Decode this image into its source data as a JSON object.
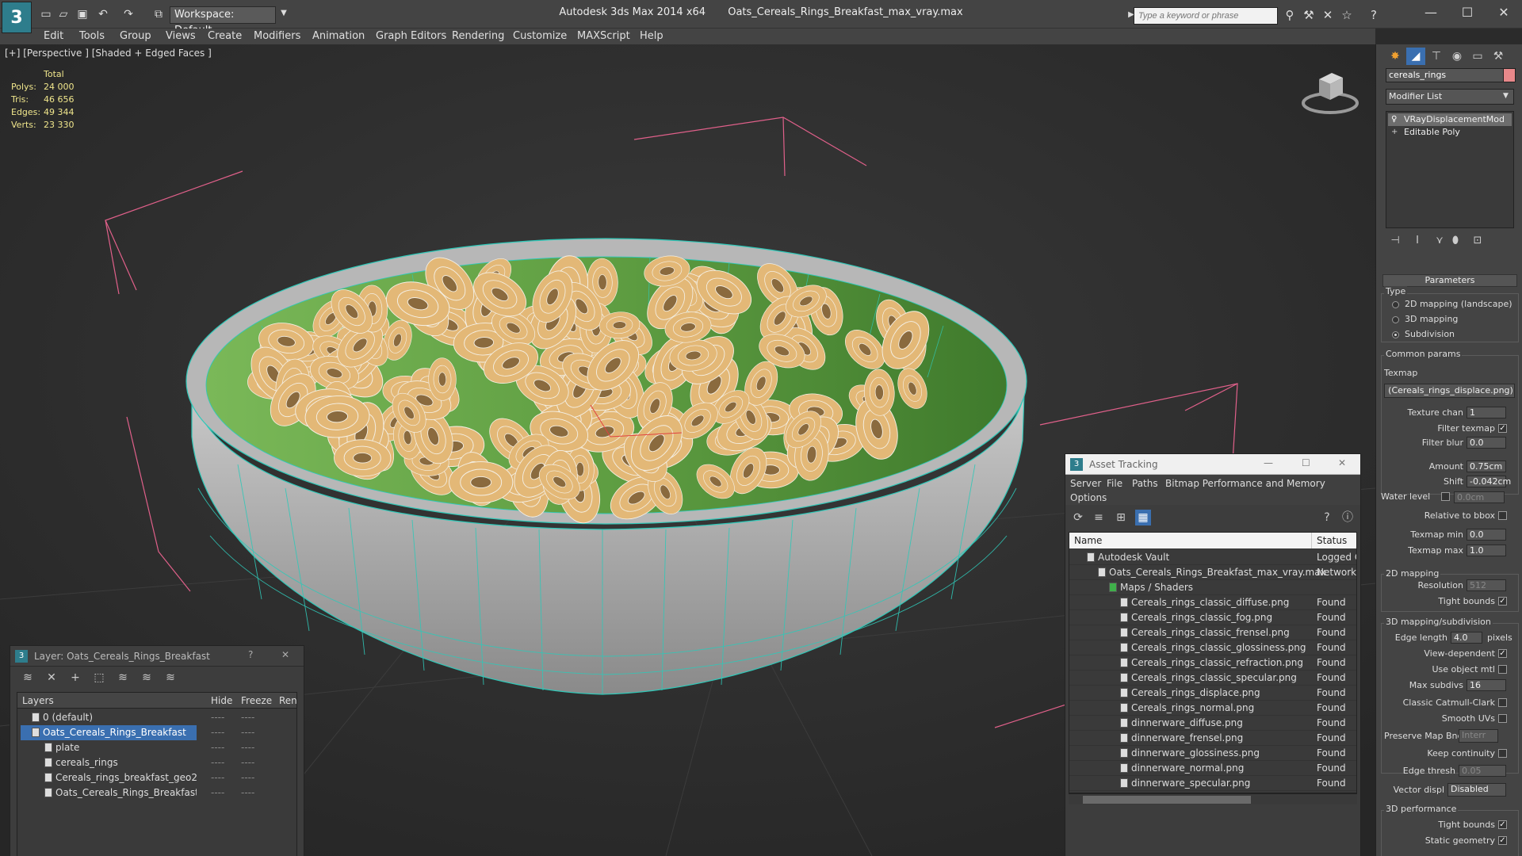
{
  "titlebar": {
    "app": "Autodesk 3ds Max  2014 x64",
    "file": "Oats_Cereals_Rings_Breakfast_max_vray.max",
    "workspace": "Workspace: Default",
    "search_placeholder": "Type a keyword or phrase",
    "logo_glyph": "3"
  },
  "menu": [
    "Edit",
    "Tools",
    "Group",
    "Views",
    "Create",
    "Modifiers",
    "Animation",
    "Graph Editors",
    "Rendering",
    "Customize",
    "MAXScript",
    "Help"
  ],
  "viewport": {
    "label": "[+] [Perspective ] [Shaded + Edged Faces ]",
    "stats": {
      "header": "Total",
      "rows": [
        {
          "label": "Polys:",
          "value": "24 000"
        },
        {
          "label": "Tris:",
          "value": "46 656"
        },
        {
          "label": "Edges:",
          "value": "49 344"
        },
        {
          "label": "Verts:",
          "value": "23 330"
        }
      ]
    },
    "colors": {
      "bowl_inner": "#6aa64a",
      "bowl_outer": "#a8a8a8",
      "wire": "#2fc8b8",
      "ring": "#e3b877",
      "bbox": "#e0608a"
    }
  },
  "layer_dialog": {
    "title": "Layer: Oats_Cereals_Rings_Breakfast",
    "help": "?",
    "close": "✕",
    "columns": [
      "Layers",
      "Hide",
      "Freeze",
      "Ren"
    ],
    "rows": [
      {
        "name": "0 (default)",
        "selected": false,
        "level": 1
      },
      {
        "name": "Oats_Cereals_Rings_Breakfast",
        "selected": true,
        "level": 1
      },
      {
        "name": "plate",
        "selected": false,
        "level": 2
      },
      {
        "name": "cereals_rings",
        "selected": false,
        "level": 2
      },
      {
        "name": "Cereals_rings_breakfast_geo2",
        "selected": false,
        "level": 2
      },
      {
        "name": "Oats_Cereals_Rings_Breakfast",
        "selected": false,
        "level": 2
      }
    ],
    "dash": "----"
  },
  "asset_dialog": {
    "title": "Asset Tracking",
    "menu": [
      "Server",
      "File",
      "Paths",
      "Bitmap Performance and Memory"
    ],
    "menu2": "Options",
    "columns": [
      "Name",
      "Status"
    ],
    "rows": [
      {
        "name": "Autodesk Vault",
        "status": "Logged C",
        "level": 1
      },
      {
        "name": "Oats_Cereals_Rings_Breakfast_max_vray.max",
        "status": "Network I",
        "level": 2
      },
      {
        "name": "Maps / Shaders",
        "status": "",
        "level": 3
      },
      {
        "name": "Cereals_rings_classic_diffuse.png",
        "status": "Found",
        "level": 4
      },
      {
        "name": "Cereals_rings_classic_fog.png",
        "status": "Found",
        "level": 4
      },
      {
        "name": "Cereals_rings_classic_frensel.png",
        "status": "Found",
        "level": 4
      },
      {
        "name": "Cereals_rings_classic_glossiness.png",
        "status": "Found",
        "level": 4
      },
      {
        "name": "Cereals_rings_classic_refraction.png",
        "status": "Found",
        "level": 4
      },
      {
        "name": "Cereals_rings_classic_specular.png",
        "status": "Found",
        "level": 4
      },
      {
        "name": "Cereals_rings_displace.png",
        "status": "Found",
        "level": 4
      },
      {
        "name": "Cereals_rings_normal.png",
        "status": "Found",
        "level": 4
      },
      {
        "name": "dinnerware_diffuse.png",
        "status": "Found",
        "level": 4
      },
      {
        "name": "dinnerware_frensel.png",
        "status": "Found",
        "level": 4
      },
      {
        "name": "dinnerware_glossiness.png",
        "status": "Found",
        "level": 4
      },
      {
        "name": "dinnerware_normal.png",
        "status": "Found",
        "level": 4
      },
      {
        "name": "dinnerware_specular.png",
        "status": "Found",
        "level": 4
      }
    ]
  },
  "command_panel": {
    "object_name": "cereals_rings",
    "modifier_list": "Modifier List",
    "stack": [
      "VRayDisplacementMod",
      "Editable Poly"
    ],
    "parameters_title": "Parameters",
    "type_label": "Type",
    "type_options": [
      {
        "label": "2D mapping (landscape)",
        "on": false
      },
      {
        "label": "3D mapping",
        "on": false
      },
      {
        "label": "Subdivision",
        "on": true
      }
    ],
    "common_label": "Common params",
    "texmap_label": "Texmap",
    "texmap_value": "(Cereals_rings_displace.png)",
    "texture_chan_label": "Texture chan",
    "texture_chan": "1",
    "filter_texmap_label": "Filter texmap",
    "filter_blur_label": "Filter blur",
    "filter_blur": "0.0",
    "amount_label": "Amount",
    "amount": "0.75cm",
    "shift_label": "Shift",
    "shift": "-0.042cm",
    "water_label": "Water level",
    "water": "0.0cm",
    "relative_label": "Relative to bbox",
    "texmap_min_label": "Texmap min",
    "texmap_min": "0.0",
    "texmap_max_label": "Texmap max",
    "texmap_max": "1.0",
    "map2d_label": "2D mapping",
    "resolution_label": "Resolution",
    "resolution": "512",
    "tight_label": "Tight bounds",
    "sub3d_label": "3D mapping/subdivision",
    "edge_len_label": "Edge length",
    "edge_len": "4.0",
    "pixels_label": "pixels",
    "view_dep_label": "View-dependent",
    "use_obj_label": "Use object mtl",
    "max_subdivs_label": "Max subdivs",
    "max_subdivs": "16",
    "catmull_label": "Classic Catmull-Clark",
    "smooth_uv_label": "Smooth UVs",
    "preserve_label": "Preserve Map Bnd",
    "preserve_value": "Interr",
    "keep_cont_label": "Keep continuity",
    "edge_thresh_label": "Edge thresh",
    "edge_thresh": "0.05",
    "vector_label": "Vector displ",
    "vector_value": "Disabled",
    "perf_label": "3D performance",
    "tight2_label": "Tight bounds",
    "static_label": "Static geometry"
  }
}
